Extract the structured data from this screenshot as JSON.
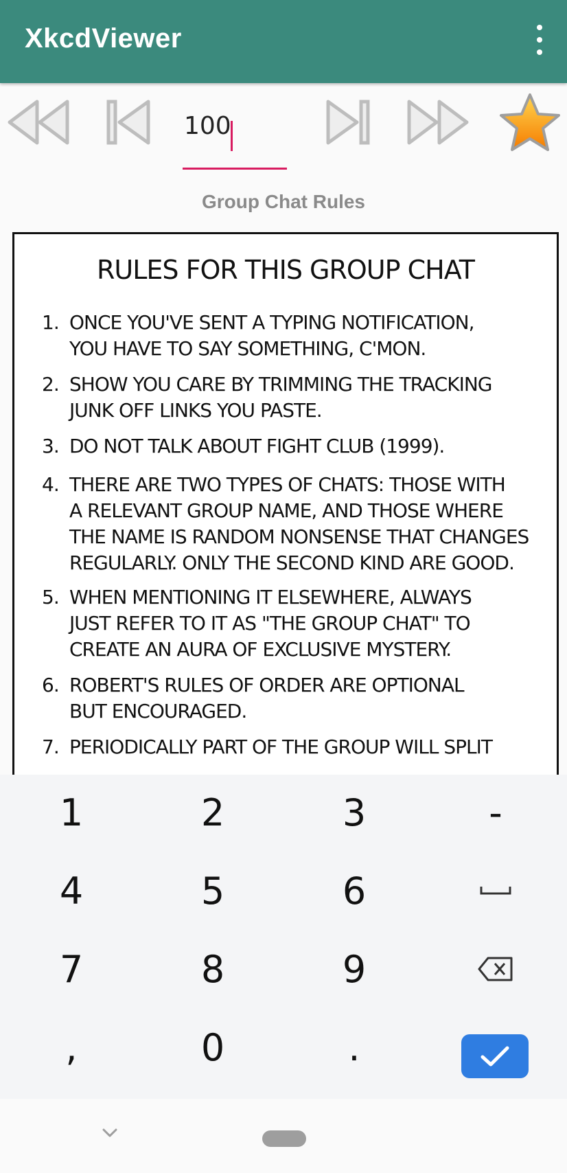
{
  "app": {
    "title": "XkcdViewer",
    "menu_icon": "more-vert-icon",
    "colors": {
      "appbar": "#3b8a7d",
      "accent": "#d81b60",
      "done_key": "#2f7de1"
    }
  },
  "navigation": {
    "first_icon": "first-comic-icon",
    "prev_icon": "previous-comic-icon",
    "comic_number": "100",
    "next_icon": "next-comic-icon",
    "last_icon": "last-comic-icon",
    "favorite_icon": "star-icon"
  },
  "comic": {
    "title": "Group Chat Rules",
    "heading": "RULES FOR THIS GROUP CHAT",
    "rules": [
      {
        "num": "1.",
        "text": "ONCE YOU'VE SENT A TYPING NOTIFICATION,\nYOU HAVE TO SAY SOMETHING, C'MON."
      },
      {
        "num": "2.",
        "text": "SHOW YOU CARE BY TRIMMING THE TRACKING\nJUNK OFF LINKS YOU PASTE."
      },
      {
        "num": "3.",
        "text": "DO NOT TALK ABOUT FIGHT CLUB (1999)."
      },
      {
        "num": "4.",
        "text": "THERE ARE TWO TYPES OF CHATS: THOSE WITH\nA RELEVANT GROUP NAME, AND THOSE WHERE\nTHE NAME IS RANDOM NONSENSE THAT CHANGES\nREGULARLY. ONLY THE SECOND KIND ARE GOOD."
      },
      {
        "num": "5.",
        "text": "WHEN MENTIONING IT ELSEWHERE, ALWAYS\nJUST REFER TO IT AS \"THE GROUP CHAT\" TO\nCREATE AN AURA OF EXCLUSIVE MYSTERY."
      },
      {
        "num": "6.",
        "text": "ROBERT'S RULES OF ORDER ARE OPTIONAL\nBUT ENCOURAGED."
      },
      {
        "num": "7.",
        "text": "PERIODICALLY PART OF THE GROUP WILL SPLIT"
      }
    ]
  },
  "keyboard": {
    "keys": [
      [
        "1",
        "2",
        "3",
        "-"
      ],
      [
        "4",
        "5",
        "6",
        "space"
      ],
      [
        "7",
        "8",
        "9",
        "backspace"
      ],
      [
        ",",
        "0",
        ".",
        "done"
      ]
    ],
    "space_icon": "space-bar-icon",
    "backspace_icon": "backspace-icon",
    "done_icon": "checkmark-icon"
  },
  "system_nav": {
    "back_icon": "chevron-down-icon",
    "home_icon": "home-pill-icon"
  }
}
